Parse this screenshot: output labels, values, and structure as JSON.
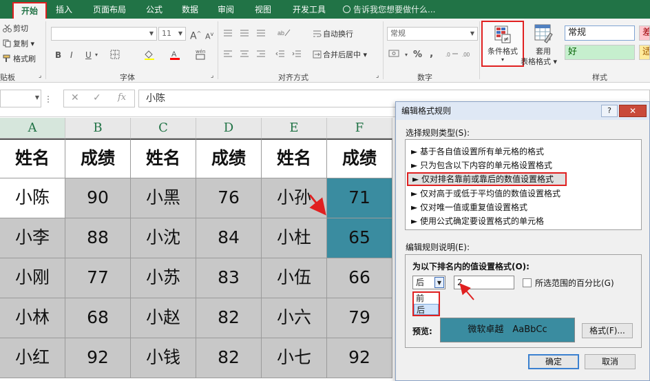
{
  "ribbon_tabs": [
    "开始",
    "插入",
    "页面布局",
    "公式",
    "数据",
    "审阅",
    "视图",
    "开发工具"
  ],
  "tell_me": "告诉我您想要做什么...",
  "clipboard": {
    "cut": "剪切",
    "copy": "复制",
    "painter": "格式刷",
    "label": "贴板"
  },
  "font": {
    "size": "11",
    "label": "字体",
    "bold": "B",
    "italic": "I",
    "underline": "U",
    "grow": "A",
    "shrink": "A"
  },
  "alignment": {
    "wrap": "自动换行",
    "merge": "合并后居中",
    "label": "对齐方式"
  },
  "number": {
    "format": "常规",
    "label": "数字",
    "percent": "%",
    "comma": ","
  },
  "styles": {
    "conditional": "条件格式",
    "table_line1": "套用",
    "table_line2": "表格格式",
    "normal": "常规",
    "bad": "差",
    "good": "好",
    "neutral": "适",
    "label": "样式"
  },
  "formula_bar": {
    "fx": "fx",
    "value": "小陈"
  },
  "columns": [
    "A",
    "B",
    "C",
    "D",
    "E",
    "F"
  ],
  "table": {
    "header": [
      "姓名",
      "成绩",
      "姓名",
      "成绩",
      "姓名",
      "成绩"
    ],
    "rows": [
      [
        "小陈",
        "90",
        "小黑",
        "76",
        "小孙",
        "71"
      ],
      [
        "小李",
        "88",
        "小沈",
        "84",
        "小杜",
        "65"
      ],
      [
        "小刚",
        "77",
        "小苏",
        "83",
        "小伍",
        "66"
      ],
      [
        "小林",
        "68",
        "小赵",
        "82",
        "小六",
        "79"
      ],
      [
        "小红",
        "92",
        "小钱",
        "82",
        "小七",
        "92"
      ]
    ]
  },
  "dialog": {
    "title": "编辑格式规则",
    "help": "?",
    "close": "✕",
    "select_type_label": "选择规则类型(S):",
    "rule_types": [
      "► 基于各自值设置所有单元格的格式",
      "► 只为包含以下内容的单元格设置格式",
      "► 仅对排名靠前或靠后的数值设置格式",
      "► 仅对高于或低于平均值的数值设置格式",
      "► 仅对唯一值或重复值设置格式",
      "► 使用公式确定要设置格式的单元格"
    ],
    "edit_desc_label": "编辑规则说明(E):",
    "format_rank_label": "为以下排名内的值设置格式(O):",
    "rank_direction": "后",
    "rank_options": [
      "前",
      "后"
    ],
    "rank_count": "2",
    "percent_label": "所选范围的百分比(G)",
    "preview_label": "预览:",
    "preview_text": "微软卓越　AaBbCc",
    "format_button": "格式(F)...",
    "ok": "确定",
    "cancel": "取消"
  },
  "colors": {
    "excel_green": "#217346",
    "highlight_teal": "#3a8ca0",
    "annotation_red": "#e02020"
  }
}
